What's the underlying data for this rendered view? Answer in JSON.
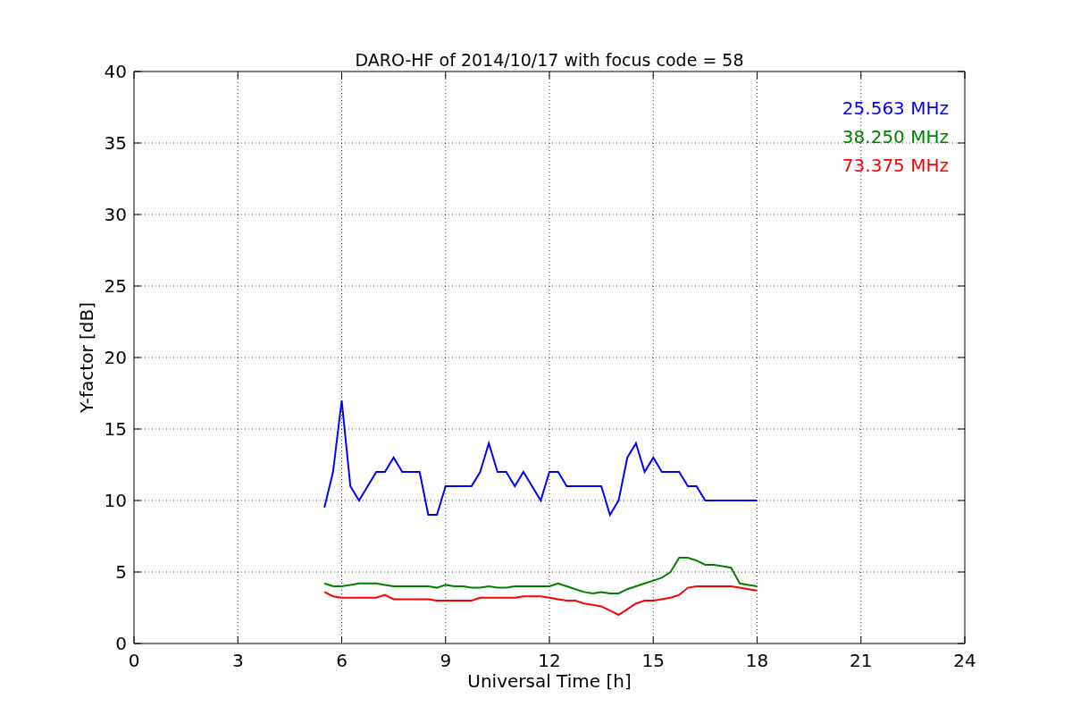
{
  "chart_data": {
    "type": "line",
    "title": "DARO-HF of 2014/10/17 with focus code = 58",
    "xlabel": "Universal Time [h]",
    "ylabel": "Y-factor [dB]",
    "x": [
      5.5,
      5.75,
      6.0,
      6.25,
      6.5,
      6.75,
      7.0,
      7.25,
      7.5,
      7.75,
      8.0,
      8.25,
      8.5,
      8.75,
      9.0,
      9.25,
      9.5,
      9.75,
      10.0,
      10.25,
      10.5,
      10.75,
      11.0,
      11.25,
      11.5,
      11.75,
      12.0,
      12.25,
      12.5,
      12.75,
      13.0,
      13.25,
      13.5,
      13.75,
      14.0,
      14.25,
      14.5,
      14.75,
      15.0,
      15.25,
      15.5,
      15.75,
      16.0,
      16.25,
      16.5,
      16.75,
      17.0,
      17.25,
      17.5,
      17.75,
      18.0
    ],
    "series": [
      {
        "name": "25.563 MHz",
        "color": "#0000ff",
        "values": [
          9.5,
          12,
          17,
          11,
          10,
          11,
          12,
          12,
          13,
          12,
          12,
          12,
          9,
          9,
          11,
          11,
          11,
          11,
          12,
          14,
          12,
          12,
          11,
          12,
          11,
          10,
          12,
          12,
          11,
          11,
          11,
          11,
          11,
          9,
          10,
          13,
          14,
          12,
          13,
          12,
          12,
          12,
          11,
          11,
          10,
          10,
          10,
          10,
          10,
          10,
          10
        ]
      },
      {
        "name": "38.250 MHz",
        "color": "#008000",
        "values": [
          4.2,
          4,
          4,
          4.1,
          4.2,
          4.2,
          4.2,
          4.1,
          4,
          4,
          4,
          4,
          4,
          3.9,
          4.1,
          4,
          4,
          3.9,
          3.9,
          4,
          3.9,
          3.9,
          4,
          4,
          4,
          4,
          4,
          4.2,
          4,
          3.8,
          3.6,
          3.5,
          3.6,
          3.5,
          3.5,
          3.8,
          4,
          4.2,
          4.4,
          4.6,
          5,
          6,
          6,
          5.8,
          5.5,
          5.5,
          5.4,
          5.3,
          4.2,
          4.1,
          4
        ]
      },
      {
        "name": "73.375 MHz",
        "color": "#ff0000",
        "values": [
          3.6,
          3.3,
          3.2,
          3.2,
          3.2,
          3.2,
          3.2,
          3.4,
          3.1,
          3.1,
          3.1,
          3.1,
          3.1,
          3,
          3,
          3,
          3,
          3,
          3.2,
          3.2,
          3.2,
          3.2,
          3.2,
          3.3,
          3.3,
          3.3,
          3.2,
          3.1,
          3,
          3,
          2.8,
          2.7,
          2.6,
          2.3,
          2,
          2.4,
          2.8,
          3,
          3,
          3.1,
          3.2,
          3.4,
          3.9,
          4,
          4,
          4,
          4,
          4,
          3.9,
          3.8,
          3.7
        ]
      }
    ],
    "grid": true,
    "xlim": [
      0,
      24
    ],
    "ylim": [
      0,
      40
    ],
    "xticks": [
      0,
      3,
      6,
      9,
      12,
      15,
      18,
      21,
      24
    ],
    "yticks": [
      0,
      5,
      10,
      15,
      20,
      25,
      30,
      35,
      40
    ]
  }
}
